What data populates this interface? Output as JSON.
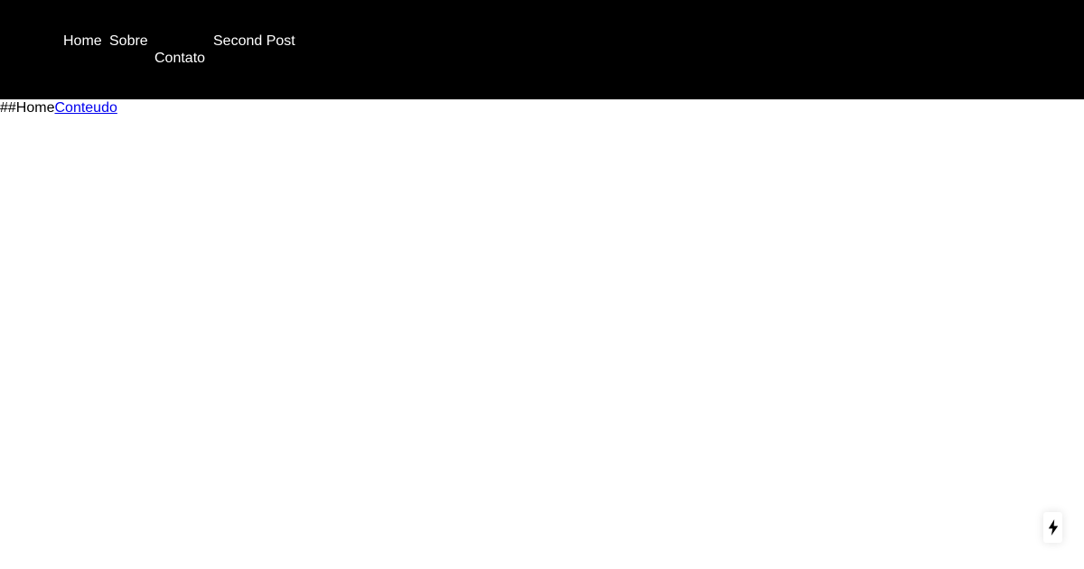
{
  "nav": {
    "items": [
      {
        "label": "Home"
      },
      {
        "label": "Sobre"
      },
      {
        "label": "Contato"
      },
      {
        "label": "Second Post"
      }
    ]
  },
  "content": {
    "heading_text": "##Home",
    "link_text": "Conteudo"
  },
  "fab": {
    "icon": "lightning-bolt-icon"
  },
  "colors": {
    "header_background": "#000000",
    "nav_text": "#ffffff",
    "link": "#0000ee"
  }
}
